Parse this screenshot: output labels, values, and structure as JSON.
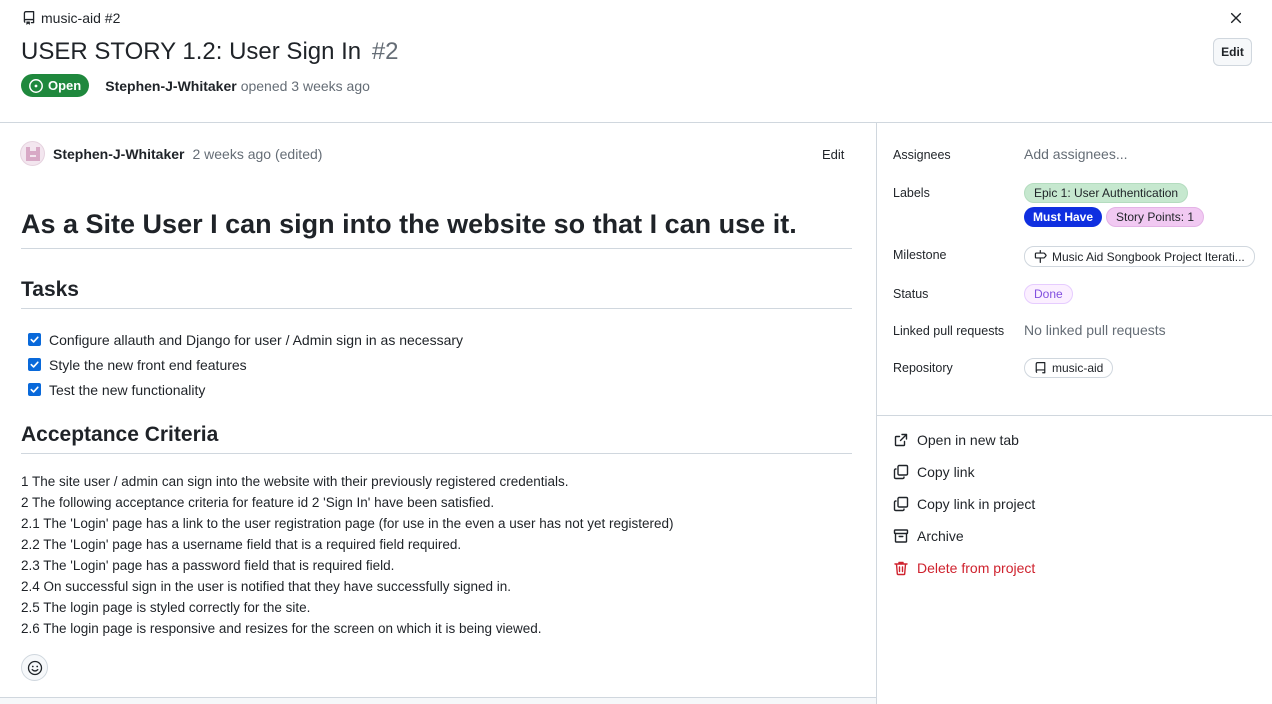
{
  "header": {
    "repo_crumb": "music-aid #2",
    "title": "USER STORY 1.2: User Sign In",
    "issue_number": "#2",
    "edit_label": "Edit",
    "state": "Open",
    "author": "Stephen-J-Whitaker",
    "opened_text": "opened 3 weeks ago"
  },
  "comment": {
    "author": "Stephen-J-Whitaker",
    "time": "2 weeks ago (edited)",
    "edit_label": "Edit",
    "heading": "As a Site User I can sign into the website so that I can use it.",
    "tasks_heading": "Tasks",
    "tasks": [
      {
        "label": "Configure allauth and Django for user / Admin sign in as necessary",
        "checked": true
      },
      {
        "label": "Style the new front end features",
        "checked": true
      },
      {
        "label": "Test the new functionality",
        "checked": true
      }
    ],
    "criteria_heading": "Acceptance Criteria",
    "criteria": [
      "1 The site user / admin can sign into the website with their previously registered credentials.",
      "2 The following acceptance criteria for feature id 2 'Sign In' have been satisfied.",
      "2.1 The 'Login' page has a link to the user registration page (for use in the even a user has not yet registered)",
      "2.2 The 'Login' page has a username field that is a required field required.",
      "2.3 The 'Login' page has a password field that is required field.",
      "2.4 On successful sign in the user is notified that they have successfully signed in.",
      "2.5 The login page is styled correctly for the site.",
      "2.6 The login page is responsive and resizes for the screen on which it is being viewed."
    ]
  },
  "sidebar": {
    "assignees_label": "Assignees",
    "assignees_value": "Add assignees...",
    "labels_label": "Labels",
    "labels": [
      {
        "text": "Epic 1: User Authentication",
        "color": "#c6e8cf"
      },
      {
        "text": "Must Have",
        "color": "#0f2fe0"
      },
      {
        "text": "Story Points: 1",
        "color": "#f1c9f2"
      }
    ],
    "milestone_label": "Milestone",
    "milestone_value": "Music Aid Songbook Project Iterati...",
    "status_label": "Status",
    "status_value": "Done",
    "linked_pr_label": "Linked pull requests",
    "linked_pr_value": "No linked pull requests",
    "repository_label": "Repository",
    "repository_value": "music-aid",
    "actions": {
      "open_new_tab": "Open in new tab",
      "copy_link": "Copy link",
      "copy_link_project": "Copy link in project",
      "archive": "Archive",
      "delete": "Delete from project"
    }
  },
  "colors": {
    "open_green": "#1f883d",
    "danger_red": "#cf222e",
    "checkbox_blue": "#0969da",
    "done_purple": "#8250df"
  }
}
